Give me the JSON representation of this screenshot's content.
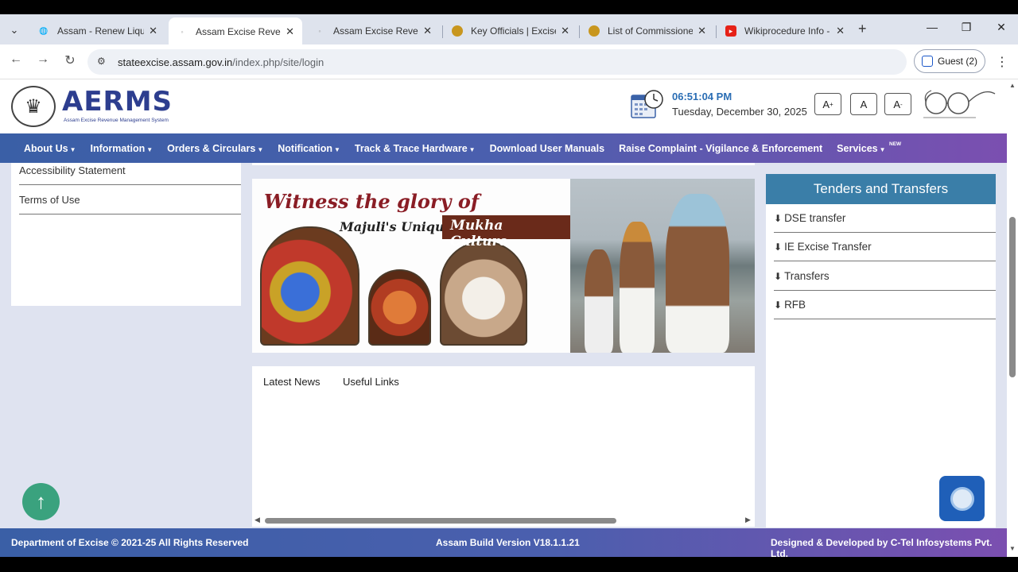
{
  "browser": {
    "tabs": [
      {
        "title": "Assam - Renew Liquo",
        "active": false
      },
      {
        "title": "Assam Excise Revenue",
        "active": true
      },
      {
        "title": "Assam Excise Revenue",
        "active": false
      },
      {
        "title": "Key Officials | Excise |",
        "active": false
      },
      {
        "title": "List of Commissioner",
        "active": false
      },
      {
        "title": "Wikiprocedure Info -",
        "active": false
      }
    ],
    "new_tab": "+",
    "url_domain": "stateexcise.assam.gov.in",
    "url_path": "/index.php/site/login",
    "profile_label": "Guest (2)"
  },
  "header": {
    "brand": "AERMS",
    "brand_sub": "Assam Excise Revenue Management System",
    "time": "06:51:04 PM",
    "date": "Tuesday, December 30, 2025",
    "font_increase": "A",
    "font_normal": "A",
    "font_decrease": "A",
    "font_increase_sup": "+",
    "font_decrease_sup": "-"
  },
  "nav": {
    "items": [
      {
        "label": "About Us",
        "dropdown": true
      },
      {
        "label": "Information",
        "dropdown": true
      },
      {
        "label": "Orders & Circulars",
        "dropdown": true
      },
      {
        "label": "Notification",
        "dropdown": true
      },
      {
        "label": "Track & Trace Hardware",
        "dropdown": true
      },
      {
        "label": "Download User Manuals",
        "dropdown": false
      },
      {
        "label": "Raise Complaint - Vigilance & Enforcement",
        "dropdown": false
      },
      {
        "label": "Services",
        "dropdown": true
      }
    ],
    "new_badge": "NEW"
  },
  "left_panel": {
    "links": [
      "Accessibility Statement",
      "Terms of Use"
    ]
  },
  "banner": {
    "line1": "Witness the glory of",
    "line2": "Majuli's Unique",
    "line3": "Mukha Culture"
  },
  "news": {
    "tabs": [
      "Latest News",
      "Useful Links"
    ]
  },
  "right_panel": {
    "title": "Tenders and Transfers",
    "items": [
      "DSE transfer",
      "IE Excise Transfer",
      "Transfers",
      "RFB"
    ]
  },
  "footer": {
    "left": "Department of Excise © 2021-25 All Rights Reserved",
    "center": "Assam Build Version V18.1.1.21",
    "right": "Designed & Developed by C-Tel Infosystems Pvt. Ltd."
  },
  "colors": {
    "nav_start": "#3a5fa6",
    "nav_end": "#7b4fb0",
    "panel_header": "#3a7ea8",
    "scroll_top_button": "#3aa27e",
    "time_color": "#2a6db4"
  }
}
